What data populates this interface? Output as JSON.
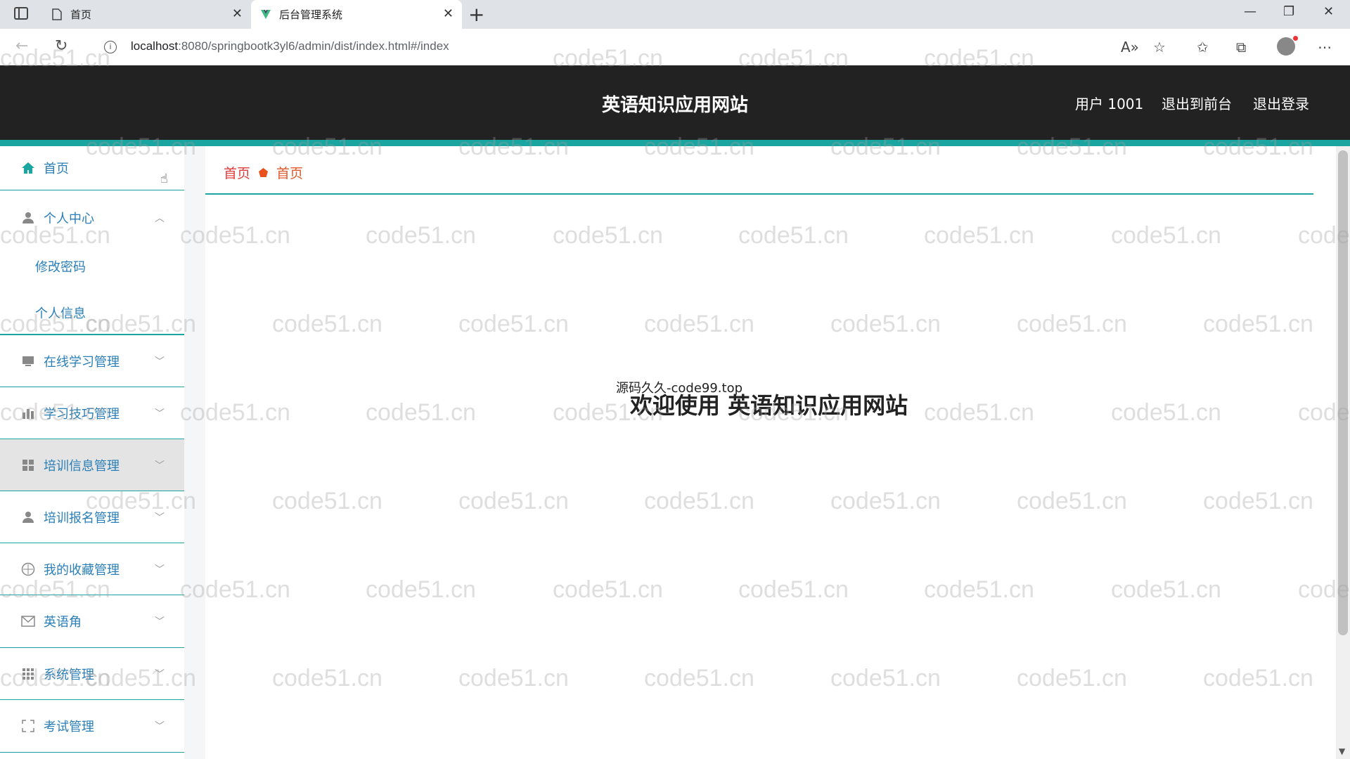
{
  "browser": {
    "tabs": [
      {
        "title": "首页"
      },
      {
        "title": "后台管理系统"
      }
    ],
    "new_tab": "+",
    "url_host": "localhost",
    "url_path": ":8080/springbootk3yl6/admin/dist/index.html#/index"
  },
  "header": {
    "title": "英语知识应用网站",
    "user": "用户 1001",
    "to_front": "退出到前台",
    "logout": "退出登录"
  },
  "sidebar": {
    "items": [
      {
        "label": "首页",
        "icon": "home-icon"
      },
      {
        "label": "个人中心",
        "icon": "user-icon",
        "expanded": true,
        "children": [
          "修改密码",
          "个人信息"
        ]
      },
      {
        "label": "在线学习管理",
        "icon": "monitor-icon"
      },
      {
        "label": "学习技巧管理",
        "icon": "chart-icon"
      },
      {
        "label": "培训信息管理",
        "icon": "grid-icon"
      },
      {
        "label": "培训报名管理",
        "icon": "user-icon"
      },
      {
        "label": "我的收藏管理",
        "icon": "compass-icon"
      },
      {
        "label": "英语角",
        "icon": "mail-icon"
      },
      {
        "label": "系统管理",
        "icon": "apps-icon"
      },
      {
        "label": "考试管理",
        "icon": "fullscreen-icon"
      }
    ]
  },
  "breadcrumb": {
    "first": "首页",
    "second": "首页"
  },
  "main": {
    "note": "源码久久-code99.top",
    "welcome": "欢迎使用 英语知识应用网站"
  },
  "watermark": "code51.cn"
}
